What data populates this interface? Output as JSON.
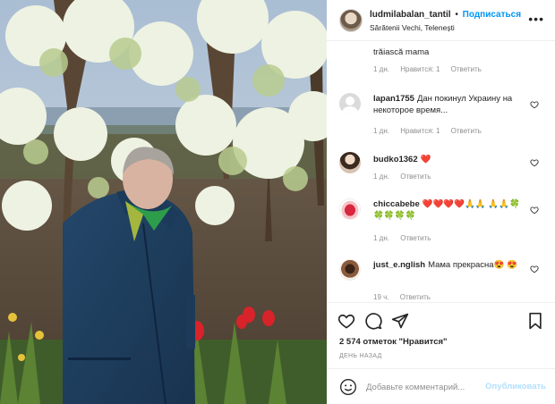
{
  "post": {
    "username": "ludmilabalan_tantil",
    "separator": "•",
    "follow_label": "Подписаться",
    "location": "Sărătenii Vechi, Telenești",
    "more_label": "•••",
    "photo_icon": "photo-of-elderly-woman-in-orchard"
  },
  "comments": [
    {
      "username": "",
      "text": "trăiască mama",
      "time": "1 дн.",
      "likes": "Нравится: 1",
      "reply": "Ответить"
    },
    {
      "username": "lapan1755",
      "text": "Дан покинул Украину на некоторое время...",
      "time": "1 дн.",
      "likes": "Нравится: 1",
      "reply": "Ответить"
    },
    {
      "username": "budko1362",
      "text": "❤️",
      "time": "1 дн.",
      "likes": "",
      "reply": "Ответить"
    },
    {
      "username": "chiccabebe",
      "text": "❤️❤️❤️❤️🙏🙏 🙏🙏🍀🍀🍀🍀🍀",
      "time": "1 дн.",
      "likes": "",
      "reply": "Ответить"
    },
    {
      "username": "just_e.nglish",
      "text": "Мама прекрасна😍 😍",
      "time": "19 ч.",
      "likes": "",
      "reply": "Ответить"
    }
  ],
  "actions": {
    "likes_text": "2 574 отметок \"Нравится\"",
    "time_ago": "ДЕНЬ НАЗАД",
    "comment_placeholder": "Добавьте комментарий...",
    "post_label": "Опубликовать"
  },
  "colors": {
    "accent": "#0095f6",
    "post_disabled": "#b2dffc",
    "muted": "#8e8e8e",
    "text": "#262626"
  }
}
